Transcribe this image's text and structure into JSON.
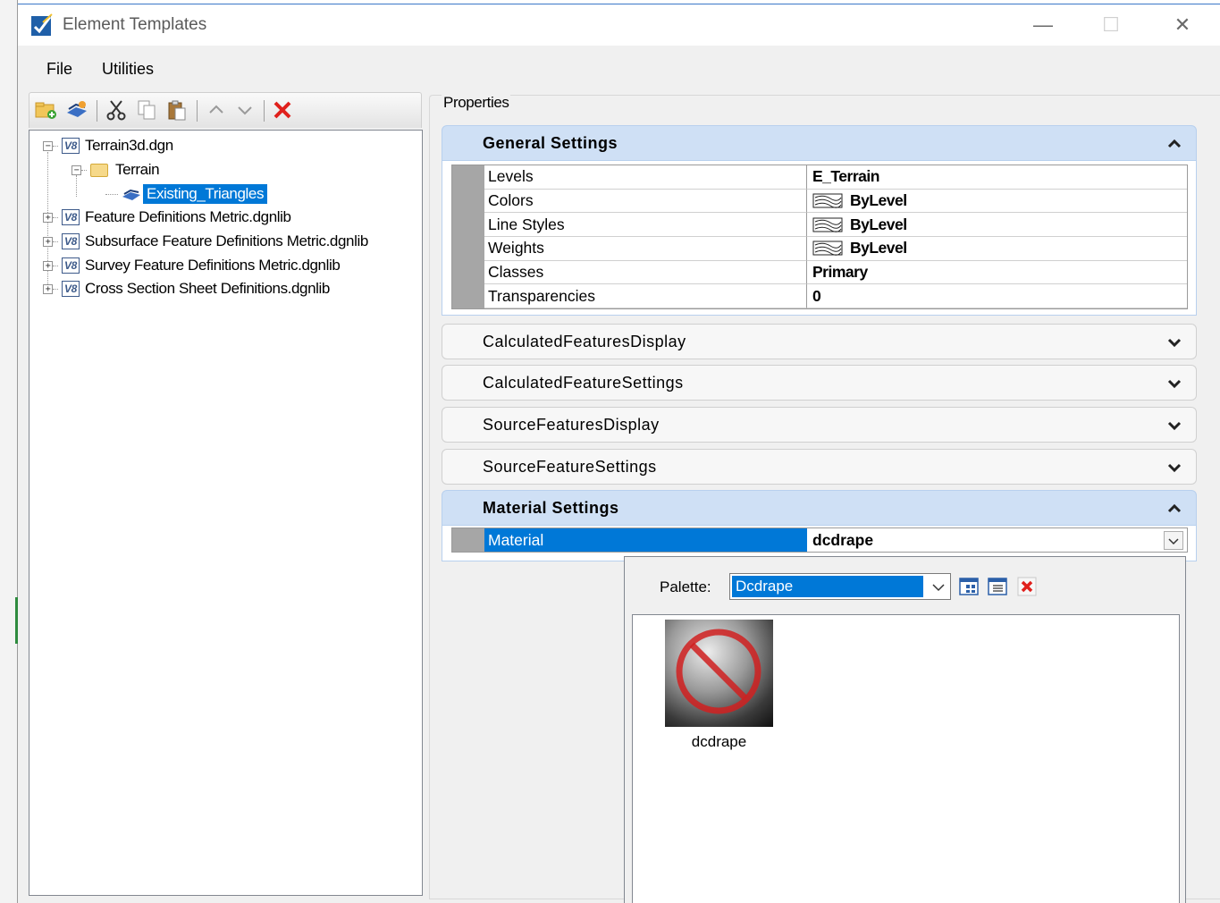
{
  "window": {
    "title": "Element Templates",
    "minimize_glyph": "—",
    "maximize_glyph": "☐",
    "close_glyph": "✕"
  },
  "menu": {
    "file": "File",
    "utilities": "Utilities"
  },
  "toolbar": {
    "icons": [
      "new-folder-icon",
      "new-template-icon",
      "cut-icon",
      "copy-icon",
      "paste-icon",
      "move-up-icon",
      "move-down-icon",
      "delete-icon"
    ]
  },
  "tree": {
    "root": "Terrain3d.dgn",
    "folder": "Terrain",
    "selected_template": "Existing_Triangles",
    "libraries": [
      "Feature Definitions Metric.dgnlib",
      "Subsurface Feature Definitions Metric.dgnlib",
      "Survey Feature Definitions Metric.dgnlib",
      "Cross Section Sheet Definitions.dgnlib"
    ],
    "v8_badge": "V8",
    "expand_glyph": "+",
    "collapse_glyph": "−"
  },
  "properties": {
    "label": "Properties",
    "general": {
      "title": "General Settings",
      "rows": [
        {
          "name": "Levels",
          "value": "E_Terrain"
        },
        {
          "name": "Colors",
          "value": "ByLevel"
        },
        {
          "name": "Line Styles",
          "value": "ByLevel"
        },
        {
          "name": "Weights",
          "value": "ByLevel"
        },
        {
          "name": "Classes",
          "value": "Primary"
        },
        {
          "name": "Transparencies",
          "value": "0"
        }
      ]
    },
    "collapsed_sections": [
      "CalculatedFeaturesDisplay",
      "CalculatedFeatureSettings",
      "SourceFeaturesDisplay",
      "SourceFeatureSettings"
    ],
    "material": {
      "title": "Material Settings",
      "row_name": "Material",
      "row_value": "dcdrape"
    }
  },
  "palette": {
    "label": "Palette:",
    "selected": "Dcdrape",
    "items": [
      {
        "name": "dcdrape"
      }
    ]
  },
  "colors": {
    "accent": "#0078d7",
    "section_header": "#cfe0f5",
    "gutter": "#a6a6a6",
    "delete_red": "#e0201c"
  }
}
